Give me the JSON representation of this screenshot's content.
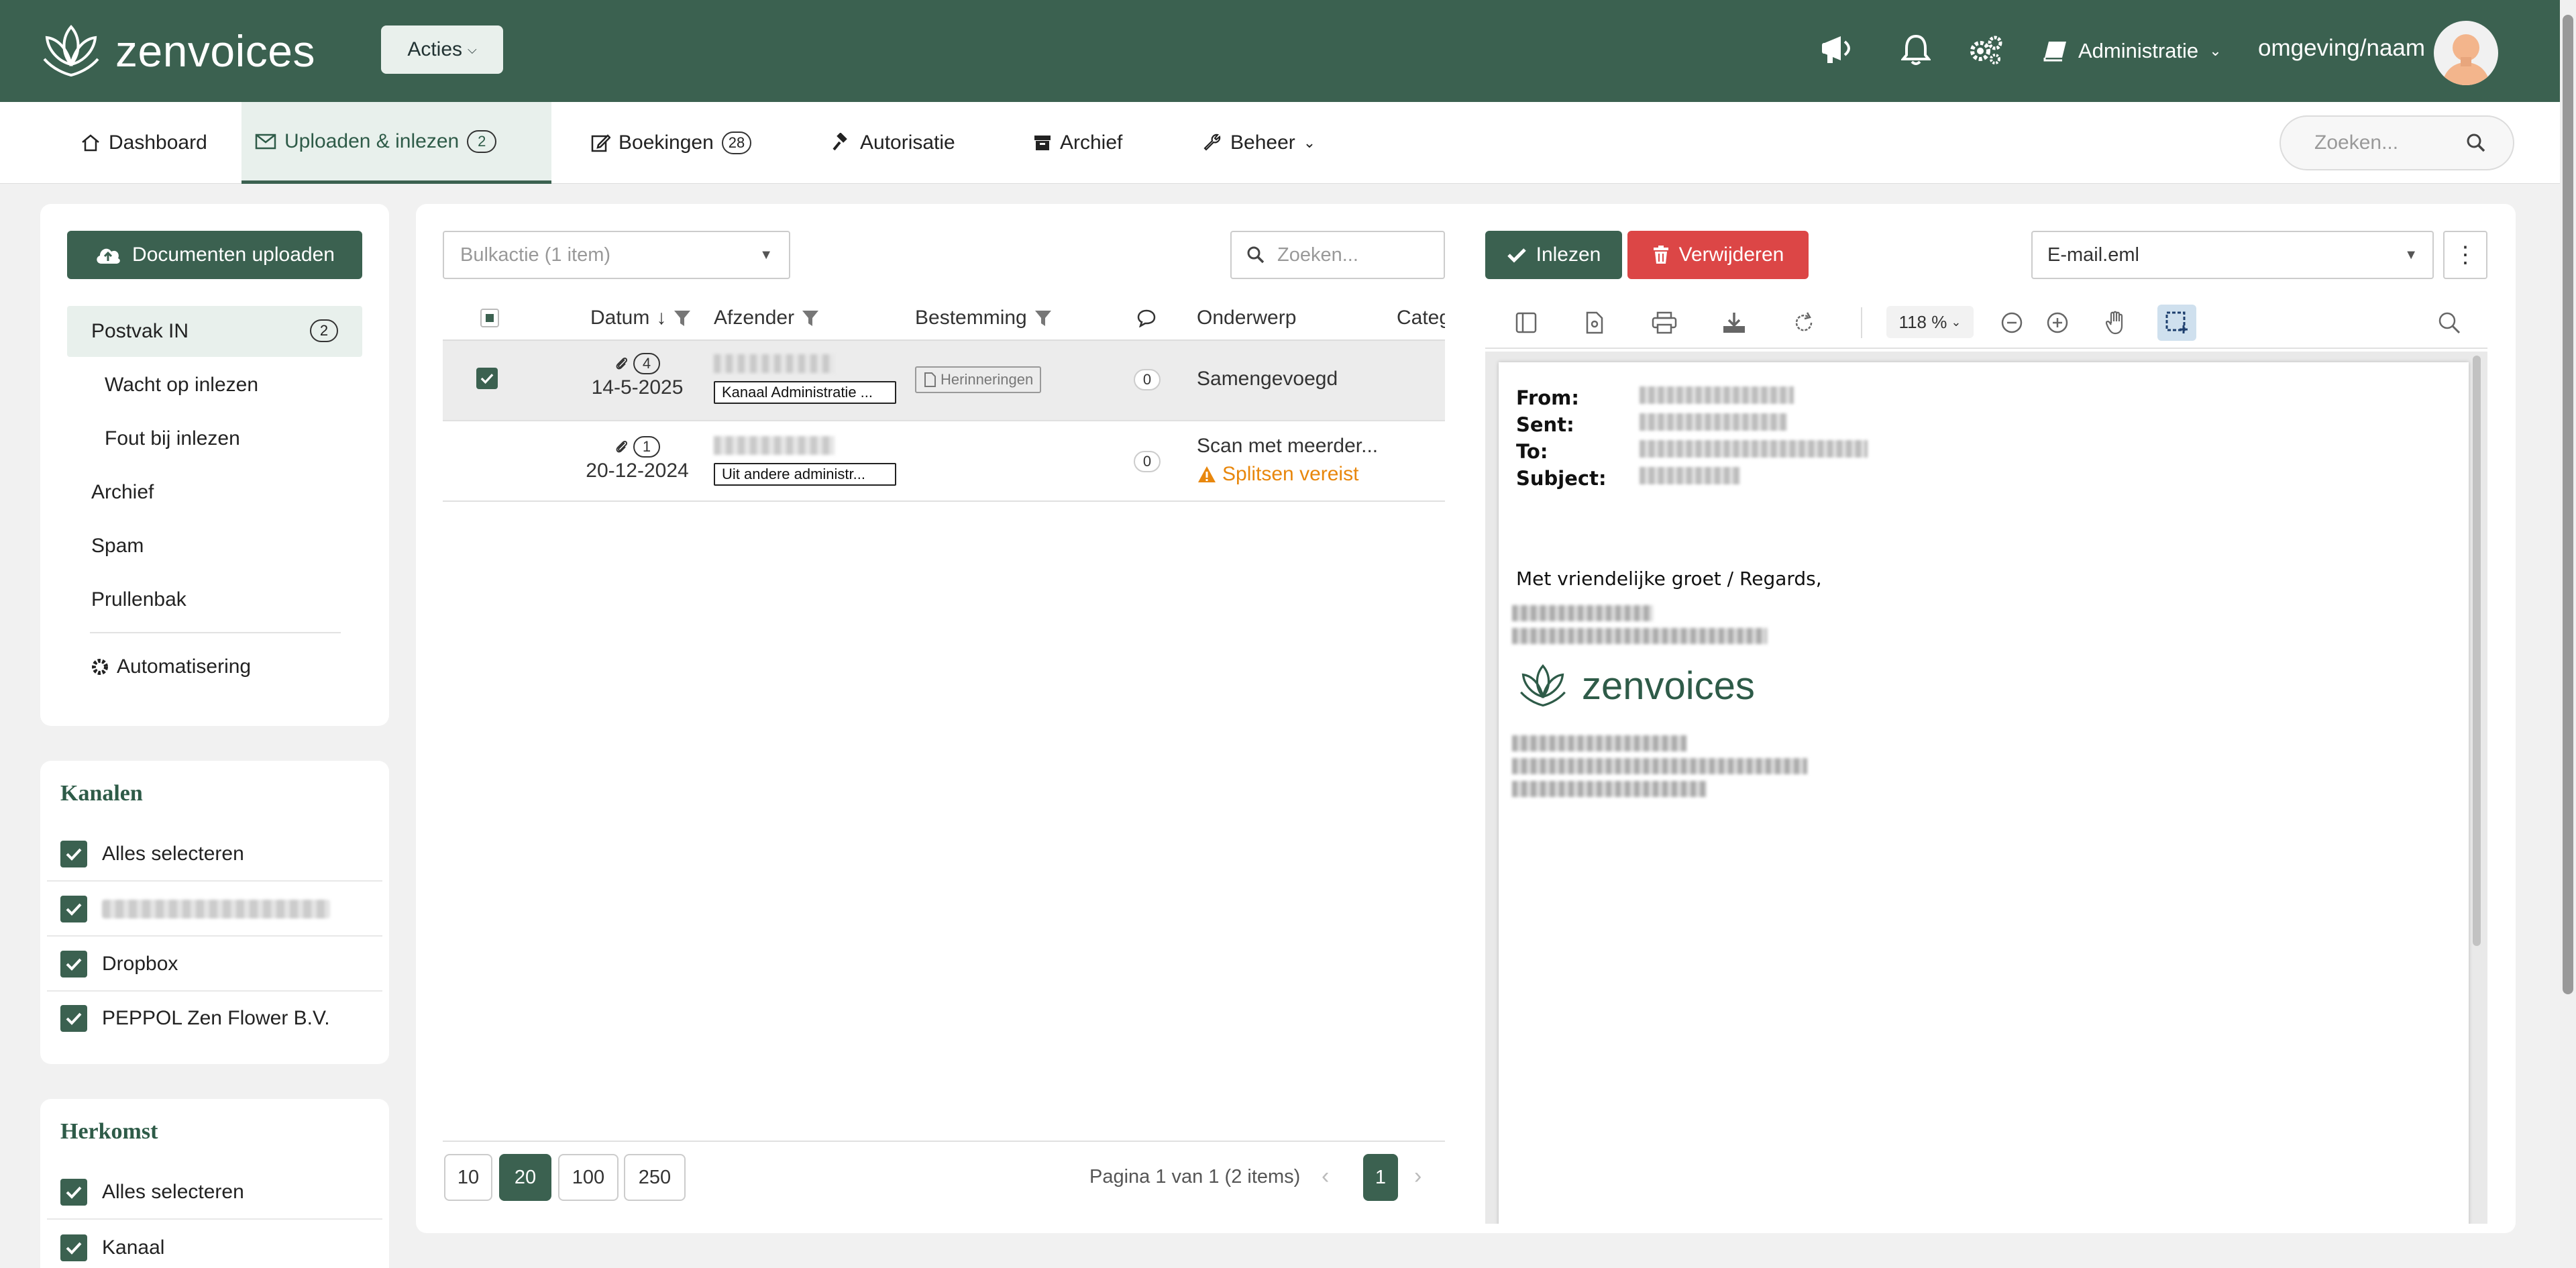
{
  "app": {
    "logo_text": "zenvoices",
    "actions_label": "Acties",
    "admin_label": "Administratie",
    "user_name": "omgeving/naam"
  },
  "nav": {
    "tabs": [
      {
        "label": "Dashboard",
        "icon": "home-icon"
      },
      {
        "label": "Uploaden & inlezen",
        "badge": "2",
        "icon": "mail-icon",
        "active": true
      },
      {
        "label": "Boekingen",
        "badge": "28",
        "icon": "edit-icon"
      },
      {
        "label": "Autorisatie",
        "icon": "gavel-icon"
      },
      {
        "label": "Archief",
        "icon": "archive-icon"
      },
      {
        "label": "Beheer",
        "icon": "wrench-icon"
      }
    ],
    "search_placeholder": "Zoeken..."
  },
  "sidebar": {
    "upload_label": "Documenten uploaden",
    "items": [
      {
        "label": "Postvak IN",
        "badge": "2",
        "active": true
      },
      {
        "label": "Wacht op inlezen"
      },
      {
        "label": "Fout bij inlezen"
      },
      {
        "label": "Archief"
      },
      {
        "label": "Spam"
      },
      {
        "label": "Prullenbak"
      },
      {
        "label": "Automatisering"
      }
    ],
    "kanalen": {
      "title": "Kanalen",
      "options": [
        "Alles selecteren",
        "",
        "Dropbox",
        "PEPPOL Zen Flower B.V."
      ]
    },
    "herkomst": {
      "title": "Herkomst",
      "options": [
        "Alles selecteren",
        "Kanaal"
      ]
    }
  },
  "list": {
    "bulk_placeholder": "Bulkactie (1 item)",
    "search_placeholder": "Zoeken...",
    "columns": [
      "Datum",
      "Afzender",
      "Bestemming",
      "Onderwerp",
      "Categ"
    ],
    "rows": [
      {
        "attachments": "4",
        "date": "14-5-2025",
        "channel": "Kanaal Administratie ...",
        "destination": "Herinneringen",
        "comments": "0",
        "subject": "Samengevoegd",
        "selected": true
      },
      {
        "attachments": "1",
        "date": "20-12-2024",
        "channel": "Uit andere administr...",
        "destination": "",
        "comments": "0",
        "subject": "Scan met meerder...",
        "warning": "Splitsen vereist"
      }
    ],
    "page_sizes": [
      "10",
      "20",
      "100",
      "250"
    ],
    "active_page_size": "20",
    "page_info": "Pagina 1 van 1 (2 items)",
    "current_page": "1"
  },
  "preview": {
    "inlezen_label": "Inlezen",
    "verwijderen_label": "Verwijderen",
    "file_name": "E-mail.eml",
    "zoom": "118 %",
    "email": {
      "fields": [
        "From:",
        "Sent:",
        "To:",
        "Subject:"
      ],
      "greeting": "Met vriendelijke groet / Regards,",
      "logo_text": "zenvoices"
    }
  },
  "colors": {
    "brand": "#3b6150",
    "danger": "#dc4646",
    "warning": "#e8870d"
  }
}
